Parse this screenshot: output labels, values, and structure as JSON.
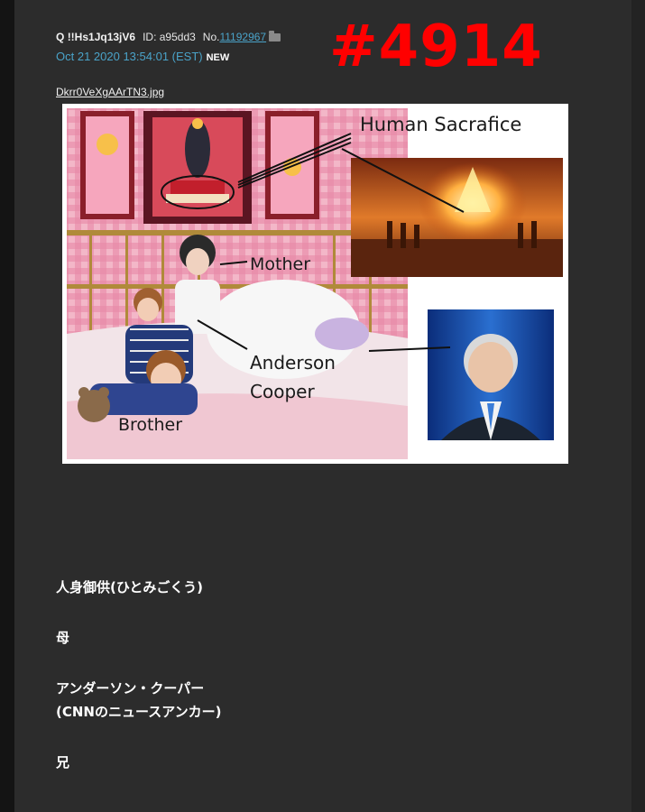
{
  "post": {
    "id_prefix": "Q",
    "tripcode": "!!Hs1Jq13jV6",
    "id_label": "ID:",
    "user_id": "a95dd3",
    "no_label": "No.",
    "post_number": "11192967",
    "timestamp": "Oct 21 2020 13:54:01 (EST)",
    "new_badge": "NEW",
    "big_tag": "#4914",
    "file_name": "Dkrr0VeXgAArTN3.jpg"
  },
  "image_labels": {
    "human_sacrifice": "Human Sacrafice",
    "mother": "Mother",
    "anderson": "Anderson",
    "cooper": "Cooper",
    "brother": "Brother"
  },
  "message": {
    "line1": "人身御供(ひとみごくう)",
    "line2": "母",
    "line3": "アンダーソン・クーパー",
    "line4": "(CNNのニュースアンカー)",
    "line5": "兄"
  },
  "colors": {
    "link": "#4aa3c9",
    "tag": "#ff0000",
    "panel": "#2c2c2c"
  }
}
